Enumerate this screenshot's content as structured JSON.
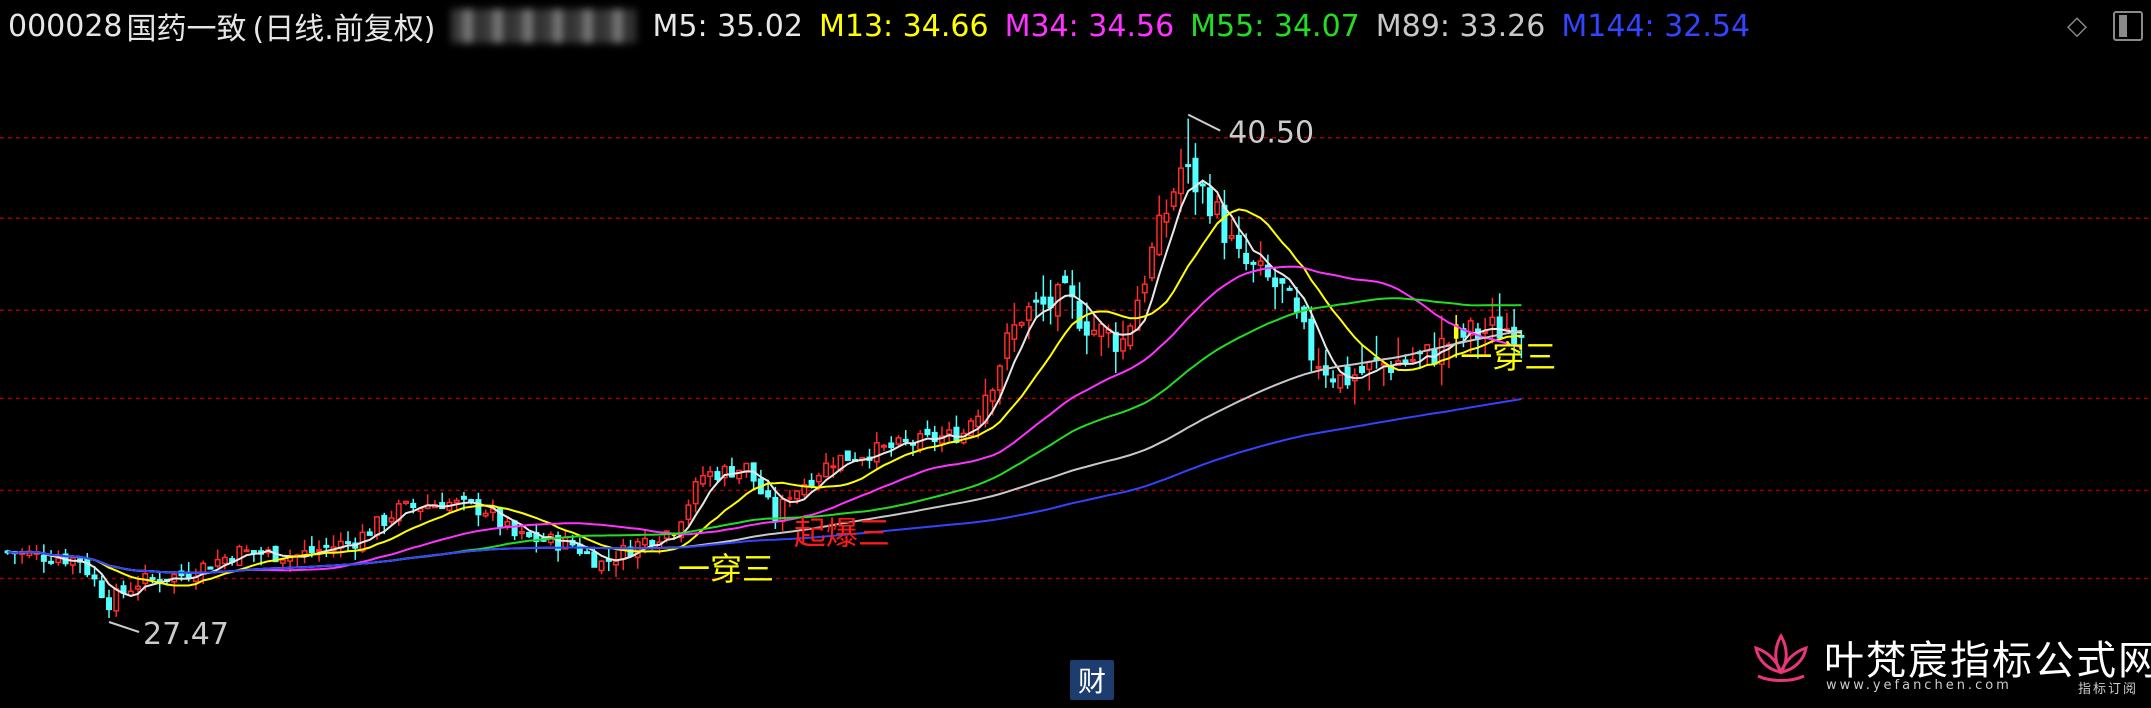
{
  "header": {
    "code": "000028",
    "name": "国药一致",
    "period": "(日线.前复权)",
    "ma_labels": [
      {
        "text": "M5: 35.02",
        "color": "#e8e8e8"
      },
      {
        "text": "M13: 34.66",
        "color": "#ffff00"
      },
      {
        "text": "M34: 34.56",
        "color": "#ff33ff"
      },
      {
        "text": "M55: 34.07",
        "color": "#22dd22"
      },
      {
        "text": "M89: 33.26",
        "color": "#c8c8c8"
      },
      {
        "text": "M144: 32.54",
        "color": "#3344ff"
      }
    ]
  },
  "icons": [
    "diamond-icon",
    "window-icon"
  ],
  "finance_badge": "财",
  "watermark": {
    "title": "叶梵宸指标公式网",
    "url": "www.yefanchen.com",
    "sub": "指标订阅"
  },
  "colors": {
    "up": "#ff2a2a",
    "down": "#54ffff",
    "grid": "#a00000",
    "background": "#000000",
    "signal_yellow": "#ffff00",
    "signal_red": "#ff1a1a",
    "annotation": "#cccccc"
  },
  "chart_data": {
    "type": "candlestick",
    "title": "000028 国药一致 (日线.前复权)",
    "ylim": [
      25.2,
      42.5
    ],
    "grid": "dashed horizontal",
    "series": [
      {
        "name": "M5",
        "last": 35.02,
        "color": "#e8e8e8"
      },
      {
        "name": "M13",
        "last": 34.66,
        "color": "#ffff00"
      },
      {
        "name": "M34",
        "last": 34.56,
        "color": "#ff33ff"
      },
      {
        "name": "M55",
        "last": 34.07,
        "color": "#22dd22"
      },
      {
        "name": "M89",
        "last": 33.26,
        "color": "#c8c8c8"
      },
      {
        "name": "M144",
        "last": 32.54,
        "color": "#3344ff"
      }
    ],
    "annotations": {
      "high": {
        "text": "40.50",
        "value": 40.5,
        "bar": 163
      },
      "low": {
        "text": "27.47",
        "value": 27.47,
        "bar": 14
      }
    },
    "signals": [
      {
        "text": "一穿三",
        "bar": 92,
        "color": "#ffff00"
      },
      {
        "text": "起爆三",
        "bar": 108,
        "color": "#ff1a1a"
      },
      {
        "text": "一穿三",
        "bar": 200,
        "color": "#ffff00"
      }
    ]
  }
}
